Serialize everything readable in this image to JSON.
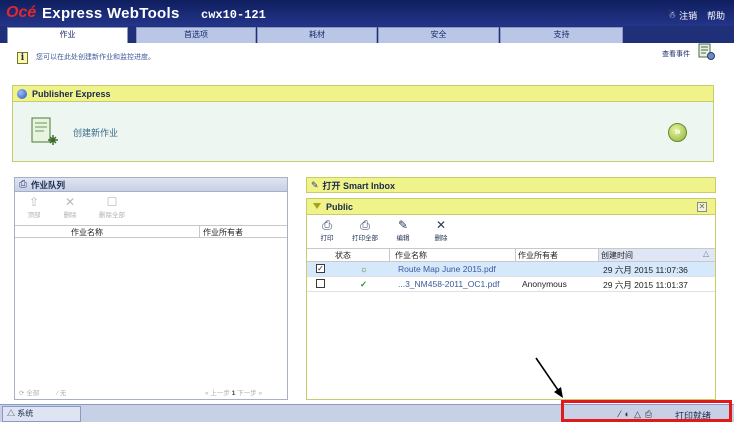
{
  "header": {
    "brand_oce": "Océ",
    "brand_name": "Express WebTools",
    "host": "cwx10-121",
    "logout": "注销",
    "help": "帮助"
  },
  "tabs": [
    "作业",
    "首选项",
    "耗材",
    "安全",
    "支持"
  ],
  "info": {
    "text": "您可以在此处创建新作业和监控进度。",
    "view_events": "查看事件"
  },
  "publisher_express": {
    "title": "Publisher Express",
    "new_job": "创建新作业"
  },
  "job_queue": {
    "title": "作业队列",
    "toolbar": [
      "顶部",
      "删除",
      "删除全部"
    ],
    "columns": {
      "name": "作业名称",
      "owner": "作业所有者"
    },
    "footer": {
      "all": "全部",
      "none": "无",
      "pager_prev": "« 上一步",
      "page": "1",
      "pager_next": "下一步 »"
    }
  },
  "smart_inbox": {
    "title": "打开 Smart Inbox"
  },
  "public": {
    "title": "Public",
    "toolbar": [
      "打印",
      "打印全部",
      "编辑",
      "删除"
    ],
    "columns": {
      "status": "状态",
      "name": "作业名称",
      "owner": "作业所有者",
      "created": "创建时间"
    },
    "rows": [
      {
        "checked": true,
        "status": "☼",
        "name": "Route Map June 2015.pdf",
        "owner": "",
        "created": "29 六月 2015 11:07:36"
      },
      {
        "checked": false,
        "status": "✓",
        "name": "...3_NM458-2011_OC1.pdf",
        "owner": "Anonymous",
        "created": "29 六月 2015 11:01:37"
      }
    ]
  },
  "statusbar": {
    "system_tab": "系统",
    "print_queue": "打印就绪"
  }
}
